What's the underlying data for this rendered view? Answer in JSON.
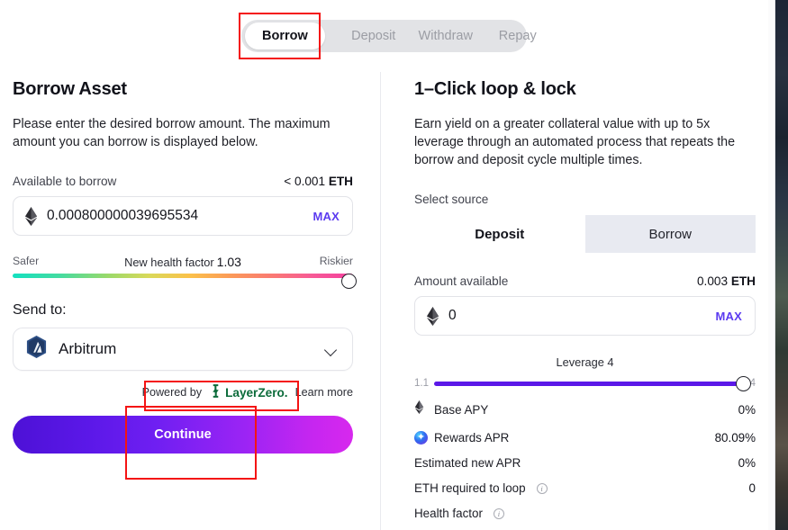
{
  "tabs": {
    "items": [
      {
        "label": "Borrow",
        "active": true
      },
      {
        "label": "Deposit",
        "active": false
      },
      {
        "label": "Withdraw",
        "active": false
      },
      {
        "label": "Repay",
        "active": false
      }
    ]
  },
  "left": {
    "title": "Borrow Asset",
    "description": "Please enter the desired borrow amount. The maximum amount you can borrow is displayed below.",
    "available_label": "Available to borrow",
    "available_value": "< 0.001",
    "available_unit": "ETH",
    "amount_value": "0.000800000039695534",
    "max_label": "MAX",
    "health": {
      "safer_label": "Safer",
      "riskier_label": "Riskier",
      "center_label": "New health factor",
      "value": "1.03"
    },
    "send_to_label": "Send to:",
    "network": "Arbitrum",
    "powered_by": "Powered by",
    "layerzero": "LayerZero.",
    "learn_more": "Learn more",
    "continue_label": "Continue"
  },
  "right": {
    "title": "1–Click loop & lock",
    "description": "Earn yield on a greater collateral value with up to 5x leverage through an automated process that repeats the borrow and deposit cycle multiple times.",
    "select_source_label": "Select source",
    "source_options": [
      {
        "label": "Deposit",
        "selected": true
      },
      {
        "label": "Borrow",
        "selected": false
      }
    ],
    "amount_available_label": "Amount available",
    "amount_available_value": "0.003",
    "amount_available_unit": "ETH",
    "amount_value": "0",
    "max_label": "MAX",
    "leverage": {
      "title": "Leverage",
      "value": "4",
      "min": "1.1",
      "max": "4"
    },
    "stats": [
      {
        "icon": "eth-icon",
        "label": "Base APY",
        "value": "0%",
        "info": false
      },
      {
        "icon": "rewards-icon",
        "label": "Rewards APR",
        "value": "80.09%",
        "info": false
      },
      {
        "icon": "none",
        "label": "Estimated new APR",
        "value": "0%",
        "info": false
      },
      {
        "icon": "none",
        "label": "ETH required to loop",
        "value": "0",
        "info": true
      },
      {
        "icon": "none",
        "label": "Health factor",
        "value": "",
        "info": true
      }
    ]
  },
  "colors": {
    "accent_purple": "#5b18e8",
    "max_link": "#5b3bf0",
    "highlight_red": "#f41414",
    "layerzero_green": "#0b6b3a"
  }
}
